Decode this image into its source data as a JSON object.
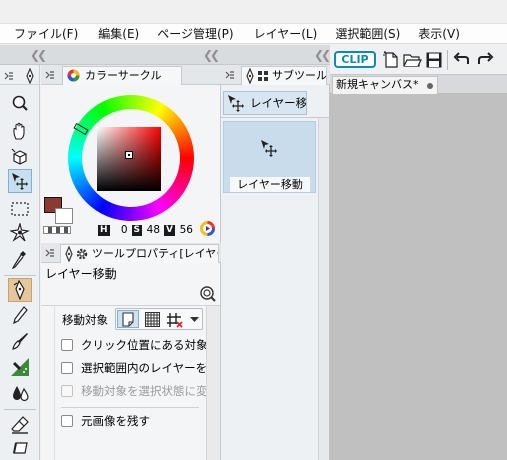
{
  "menu": [
    {
      "label": "ファイル(F)"
    },
    {
      "label": "編集(E)"
    },
    {
      "label": "ページ管理(P)"
    },
    {
      "label": "レイヤー(L)"
    },
    {
      "label": "選択範囲(S)"
    },
    {
      "label": "表示(V)"
    }
  ],
  "toolbar": {
    "logo_text": "CLIP"
  },
  "document": {
    "tab_label": "新規キャンバス*"
  },
  "tool_palette": {
    "tools": [
      {
        "name": "zoom-tool",
        "icon": "magnifier-icon"
      },
      {
        "name": "move-tool",
        "icon": "hand-icon"
      },
      {
        "name": "operation-tool",
        "icon": "cube-icon"
      },
      {
        "name": "move-layer-tool",
        "icon": "move-layer-icon",
        "active": true
      },
      {
        "name": "selection-tool",
        "icon": "marquee-icon"
      },
      {
        "name": "auto-select-tool",
        "icon": "magic-wand-icon"
      },
      {
        "name": "eyedropper-tool",
        "icon": "eyedropper-icon"
      },
      {
        "name": "pen-tool",
        "icon": "pen-nib-icon"
      },
      {
        "name": "pencil-tool",
        "icon": "pencil-icon"
      },
      {
        "name": "brush-tool",
        "icon": "brush-icon"
      },
      {
        "name": "airbrush-tool",
        "icon": "airbrush-icon"
      },
      {
        "name": "blend-tool",
        "icon": "droplets-icon"
      },
      {
        "name": "eraser-tool",
        "icon": "eraser-icon"
      }
    ]
  },
  "color_panel": {
    "title": "カラーサークル",
    "current_color": "#8a3a32",
    "h_label": "H",
    "h_value": "0",
    "s_label": "S",
    "s_value": "48",
    "v_label": "V",
    "v_value": "56"
  },
  "tool_property": {
    "title": "ツールプロパティ[レイヤー移動]",
    "tool_name": "レイヤー移動",
    "move_target_label": "移動対象",
    "options": [
      {
        "label": "クリック位置にある対象を移動",
        "checked": false,
        "disabled": false
      },
      {
        "label": "選択範囲内のレイヤーを移動",
        "checked": false,
        "disabled": false
      },
      {
        "label": "移動対象を選択状態に変更",
        "checked": false,
        "disabled": true
      },
      {
        "label": "元画像を残す",
        "checked": false,
        "disabled": false
      }
    ]
  },
  "sub_tool": {
    "title": "サブツール",
    "group_label": "レイヤー移動",
    "items": [
      {
        "label": "レイヤー移動",
        "selected": true
      }
    ]
  },
  "colors": {
    "accent": "#3c78b4",
    "logo": "#0b8bb0",
    "selected_bg": "#c8dff0",
    "canvas_bg": "#c0c0c0"
  }
}
